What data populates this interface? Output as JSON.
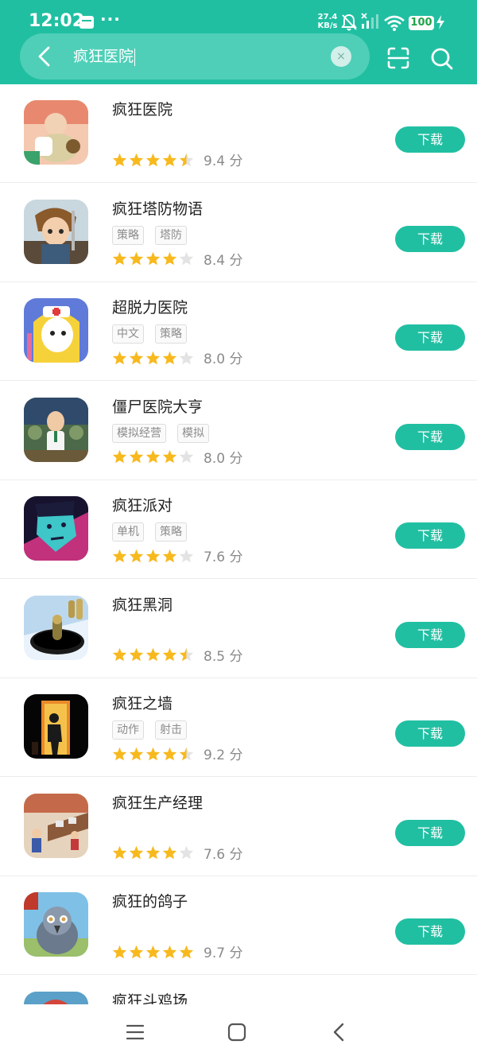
{
  "status_bar": {
    "time": "12:02",
    "more_dots": "···",
    "net_speed_value": "27.4",
    "net_speed_unit": "KB/s",
    "battery": "100"
  },
  "search": {
    "query": "疯狂医院",
    "clear_glyph": "×"
  },
  "download_label": "下载",
  "score_unit": "分",
  "apps": [
    {
      "name": "疯狂医院",
      "tags": [],
      "stars": 4.5,
      "score": "9.4",
      "icon": "hospital-game-icon"
    },
    {
      "name": "疯狂塔防物语",
      "tags": [
        "策略",
        "塔防"
      ],
      "stars": 4,
      "score": "8.4",
      "icon": "tower-defense-hero-icon"
    },
    {
      "name": "超脱力医院",
      "tags": [
        "中文",
        "策略"
      ],
      "stars": 4,
      "score": "8.0",
      "icon": "nurse-character-icon"
    },
    {
      "name": "僵尸医院大亨",
      "tags": [
        "模拟经营",
        "模拟"
      ],
      "stars": 4,
      "score": "8.0",
      "icon": "zombie-doctor-icon"
    },
    {
      "name": "疯狂派对",
      "tags": [
        "单机",
        "策略"
      ],
      "stars": 4,
      "score": "7.6",
      "icon": "neon-face-icon"
    },
    {
      "name": "疯狂黑洞",
      "tags": [],
      "stars": 4.5,
      "score": "8.5",
      "icon": "black-hole-icon"
    },
    {
      "name": "疯狂之墙",
      "tags": [
        "动作",
        "射击"
      ],
      "stars": 4.5,
      "score": "9.2",
      "icon": "doorway-silhouette-icon"
    },
    {
      "name": "疯狂生产经理",
      "tags": [],
      "stars": 4,
      "score": "7.6",
      "icon": "factory-workers-icon"
    },
    {
      "name": "疯狂的鸽子",
      "tags": [],
      "stars": 5,
      "score": "9.7",
      "icon": "pigeon-icon"
    },
    {
      "name": "疯狂斗鸡场",
      "tags": [],
      "stars": 0,
      "score": "",
      "icon": "cockfight-icon"
    }
  ],
  "colors": {
    "brand": "#21bfa2",
    "search_pill": "#4fcfb8",
    "star_on": "#f7b91e",
    "star_off": "#e3e3e3"
  },
  "icons": {
    "back": "chevron-left-icon",
    "scan": "scan-icon",
    "search": "search-icon",
    "nav_menu": "menu-icon",
    "nav_home": "home-square-icon",
    "nav_back": "back-triangle-icon"
  }
}
